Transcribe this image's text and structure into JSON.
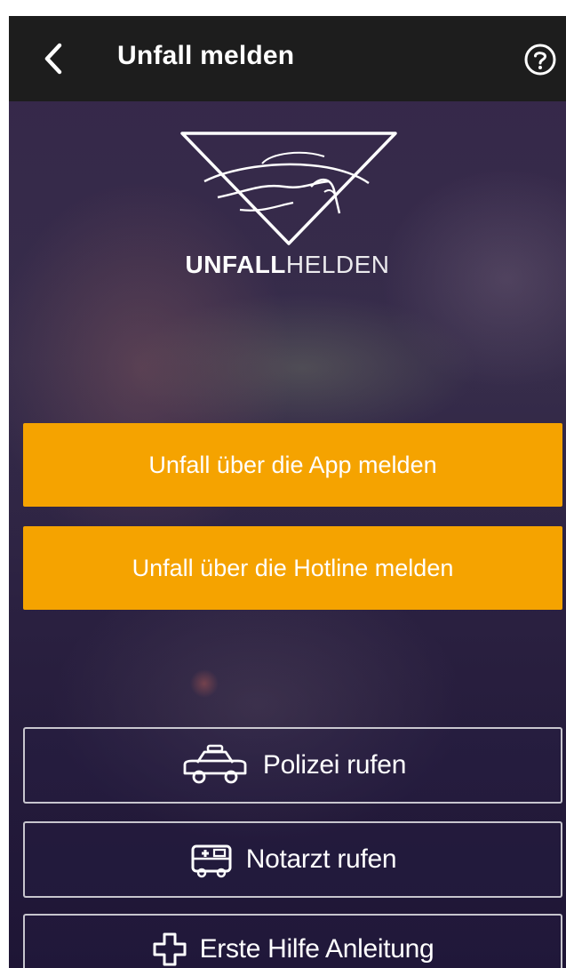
{
  "header": {
    "title": "Unfall melden",
    "back_icon": "chevron-left-icon",
    "help_icon": "help-circle-icon"
  },
  "logo": {
    "text_strong": "UNFALL",
    "text_light": "HELDEN"
  },
  "actions": {
    "report_app_label": "Unfall über die App melden",
    "report_hotline_label": "Unfall über die Hotline melden"
  },
  "emergency": {
    "police_label": "Polizei rufen",
    "police_icon": "police-car-icon",
    "doctor_label": "Notarzt rufen",
    "doctor_icon": "ambulance-icon",
    "first_aid_label": "Erste Hilfe Anleitung",
    "first_aid_icon": "medical-cross-icon"
  },
  "colors": {
    "topbar": "#1d1d1d",
    "accent": "#f5a300",
    "text": "#ffffff"
  }
}
